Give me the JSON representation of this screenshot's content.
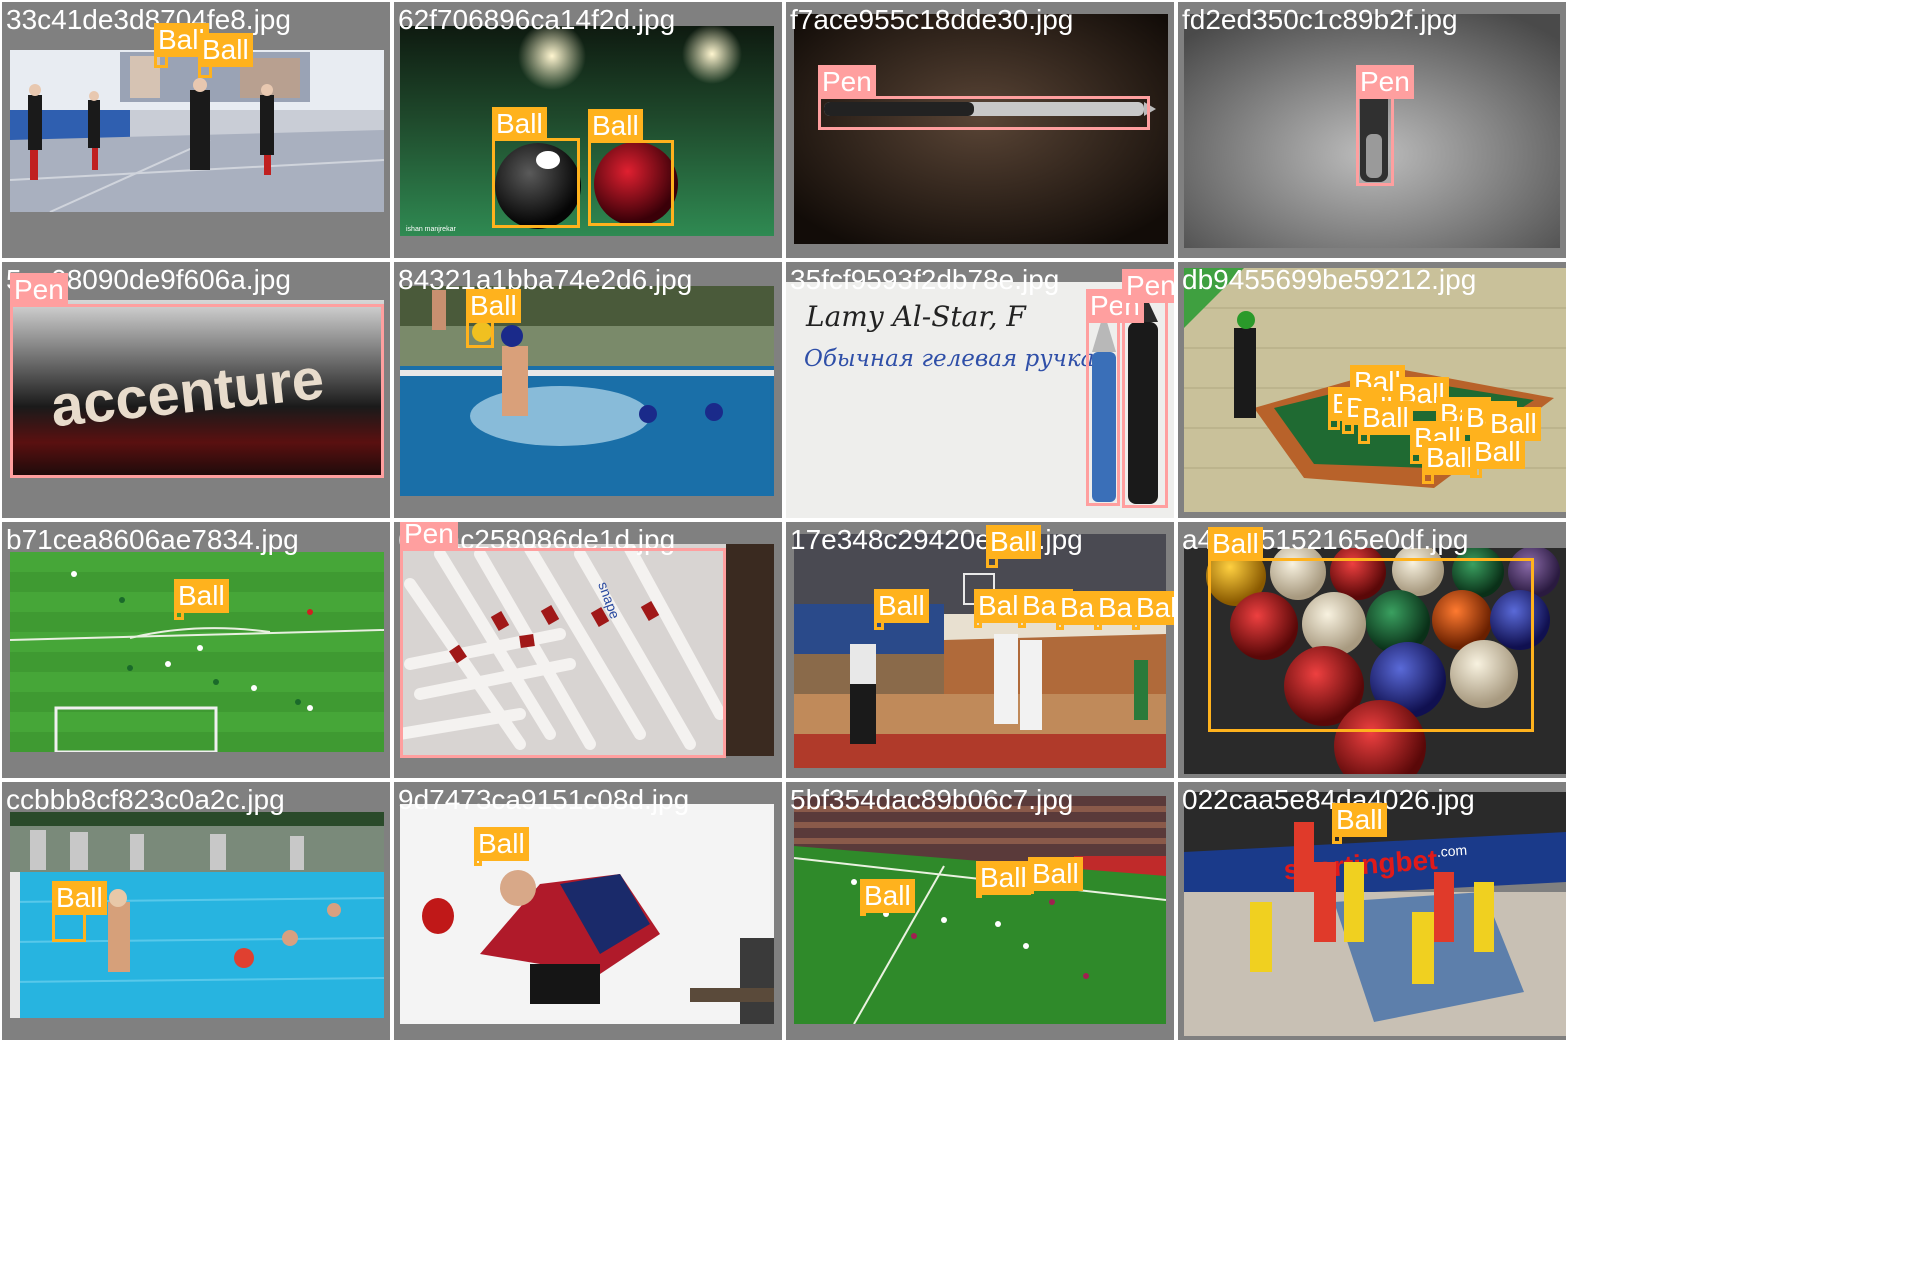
{
  "tiles": [
    {
      "file": "33c41de3d8704fe8.jpg",
      "scene": "volleyball-hall"
    },
    {
      "file": "62f706896ca14f2d.jpg",
      "scene": "billiard-closeup"
    },
    {
      "file": "f7ace955c18dde30.jpg",
      "scene": "pen-on-leather"
    },
    {
      "file": "fd2ed350c1c89b2f.jpg",
      "scene": "pen-on-concrete"
    },
    {
      "file": "5ec08090de9f606a.jpg",
      "scene": "pen-macro"
    },
    {
      "file": "84321a1bba74e2d6.jpg",
      "scene": "waterpolo-pool"
    },
    {
      "file": "35fcf9593f2db78e.jpg",
      "scene": "handwriting"
    },
    {
      "file": "db9455699be59212.jpg",
      "scene": "billiard-game"
    },
    {
      "file": "b71cea8606ae7834.jpg",
      "scene": "football-field"
    },
    {
      "file": "6??ac258086de1d.jpg",
      "scene": "many-pens"
    },
    {
      "file": "17e348c29420e6??.jpg",
      "scene": "basketball-hall"
    },
    {
      "file": "a4??75152165e0df.jpg",
      "scene": "billiard-rack"
    },
    {
      "file": "ccbbb8cf823c0a2c.jpg",
      "scene": "waterpolo-outdoor"
    },
    {
      "file": "9d7473ca9151c08d.jpg",
      "scene": "table-tennis"
    },
    {
      "file": "5bf354dac89b06c7.jpg",
      "scene": "football-stadium"
    },
    {
      "file": "022caa5e84da4026.jpg",
      "scene": "basketball-court"
    }
  ],
  "labels": {
    "ball": "Ball",
    "pen": "Pen"
  },
  "colors": {
    "ball": "#ffb21d",
    "pen": "#ff9f9f",
    "tile_bg": "#808080"
  },
  "photo_text": {
    "credit_billiard": "ishan manjrekar",
    "brand": "accenture",
    "handwriting_line1": "Lamy Al-Star, F",
    "handwriting_line2": "Обычная гелевая ручка",
    "pen_brand": "snape",
    "sponsor": "sportingbet",
    "sponsor_domain": ".com"
  }
}
